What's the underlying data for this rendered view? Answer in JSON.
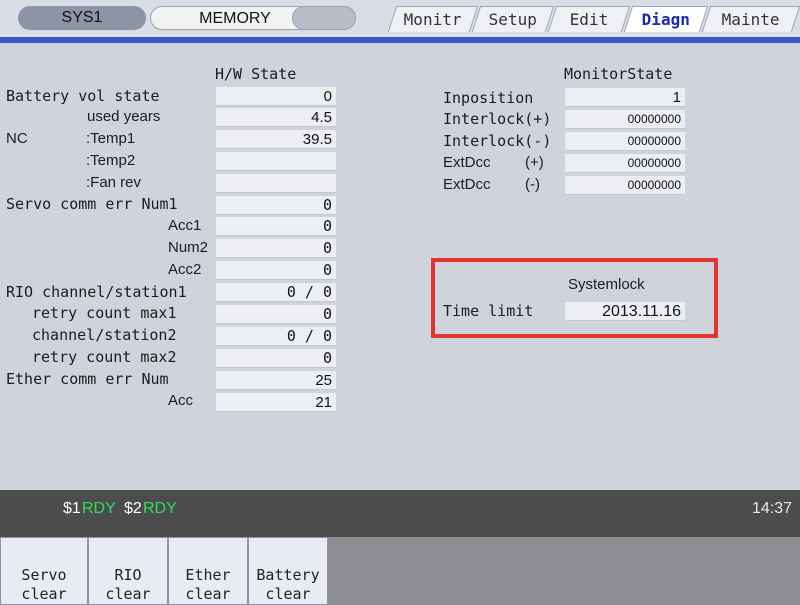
{
  "topbar": {
    "sys": "SYS1",
    "memory": "MEMORY",
    "tabs": [
      "Monitr",
      "Setup",
      "Edit",
      "Diagn",
      "Mainte"
    ],
    "active_tab": "Diagn"
  },
  "hw": {
    "header": "H/W State",
    "rows": [
      {
        "label": "Battery vol state",
        "value": "0"
      },
      {
        "label": "used years",
        "value": "4.5"
      },
      {
        "label": "NC",
        "sub": ":Temp1",
        "value": "39.5"
      },
      {
        "label": ":Temp2",
        "value": ""
      },
      {
        "label": ":Fan rev",
        "value": ""
      },
      {
        "label": "Servo comm err Num1",
        "value": "0"
      },
      {
        "label": "Acc1",
        "value": "0"
      },
      {
        "label": "Num2",
        "value": "0"
      },
      {
        "label": "Acc2",
        "value": "0"
      },
      {
        "label": "RIO channel/station1",
        "value": "0 / 0"
      },
      {
        "label": "retry count max1",
        "value": "0"
      },
      {
        "label": "channel/station2",
        "value": "0 / 0"
      },
      {
        "label": "retry count max2",
        "value": "0"
      },
      {
        "label": "Ether comm err Num",
        "value": "25"
      },
      {
        "label": "Acc",
        "value": "21"
      }
    ]
  },
  "monitor": {
    "header": "MonitorState",
    "rows": [
      {
        "label": "Inposition",
        "value": "1"
      },
      {
        "label": "Interlock(+)",
        "value": "00000000"
      },
      {
        "label": "Interlock(-)",
        "value": "00000000"
      },
      {
        "label": "ExtDcc",
        "sign": "(+)",
        "value": "00000000"
      },
      {
        "label": "ExtDcc",
        "sign": "(-)",
        "value": "00000000"
      }
    ]
  },
  "systemlock": {
    "header": "Systemlock",
    "label": "Time limit",
    "value": "2013.11.16"
  },
  "status": {
    "ch1": "$1",
    "ch1_state": "RDY",
    "ch2": "$2",
    "ch2_state": "RDY",
    "time": "14:37"
  },
  "softkeys": [
    {
      "line1": "Servo",
      "line2": "clear"
    },
    {
      "line1": "RIO",
      "line2": "clear"
    },
    {
      "line1": "Ether",
      "line2": "clear"
    },
    {
      "line1": "Battery",
      "line2": "clear"
    }
  ],
  "colors": {
    "accent_blue": "#3b55c4",
    "highlight_red": "#e3342f",
    "ready_green": "#2ee05a"
  }
}
